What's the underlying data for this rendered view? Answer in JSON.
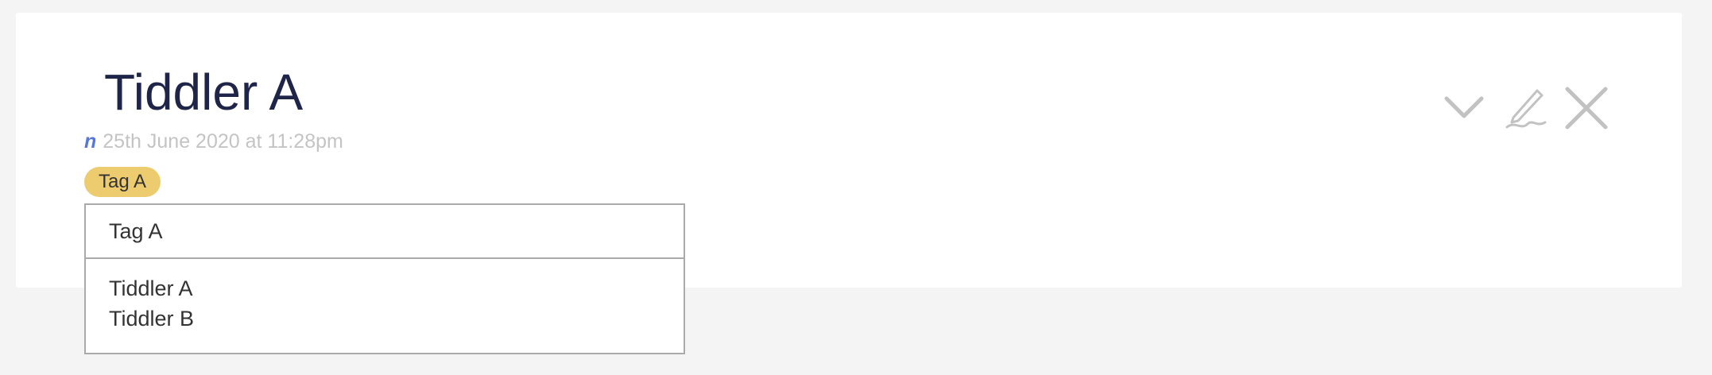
{
  "tiddler": {
    "title": "Tiddler A",
    "modifier": "n",
    "modified": "25th June 2020 at 11:28pm"
  },
  "toolbar": {
    "buttons": [
      {
        "name": "fold-button",
        "icon": "chevron-down-icon"
      },
      {
        "name": "edit-button",
        "icon": "pencil-icon"
      },
      {
        "name": "close-button",
        "icon": "close-icon"
      }
    ],
    "icon_color": "#c0c0c0"
  },
  "tags": [
    {
      "label": "Tag A",
      "color": "#eccc6f"
    }
  ],
  "tag_dropdown": {
    "header": "Tag A",
    "items": [
      "Tiddler A",
      "Tiddler B"
    ]
  }
}
